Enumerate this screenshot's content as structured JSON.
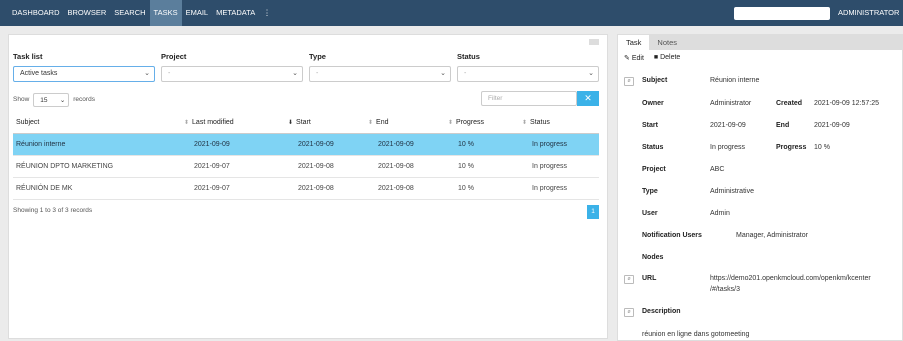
{
  "nav": {
    "items": [
      "DASHBOARD",
      "BROWSER",
      "SEARCH",
      "TASKS",
      "EMAIL",
      "METADATA"
    ],
    "active": "TASKS",
    "more": "⋮",
    "user": "ADMINISTRATOR ▾",
    "search_value": ""
  },
  "filters": {
    "task_list": {
      "label": "Task list",
      "value": "Active tasks"
    },
    "project": {
      "label": "Project",
      "value": "-"
    },
    "type": {
      "label": "Type",
      "value": "-"
    },
    "status": {
      "label": "Status",
      "value": "-"
    }
  },
  "table_controls": {
    "show_label": "Show",
    "show_value": "15",
    "records_label": "records",
    "filter_placeholder": "Filter",
    "filter_button": "✕"
  },
  "columns": [
    "Subject",
    "Last modified",
    "Start",
    "End",
    "Progress",
    "Status"
  ],
  "rows": [
    {
      "subject": "Réunion interne",
      "modified": "2021-09-09",
      "start": "2021-09-09",
      "end": "2021-09-09",
      "progress": "10 %",
      "status": "In progress"
    },
    {
      "subject": "RÉUNION DPTO MARKETING",
      "modified": "2021-09-07",
      "start": "2021-09-08",
      "end": "2021-09-08",
      "progress": "10 %",
      "status": "In progress"
    },
    {
      "subject": "RÉUNIÓN DE MK",
      "modified": "2021-09-07",
      "start": "2021-09-08",
      "end": "2021-09-08",
      "progress": "10 %",
      "status": "In progress"
    }
  ],
  "summary": "Showing 1 to 3 of 3 records",
  "pagination": {
    "current": "1"
  },
  "detail": {
    "tabs": [
      "Task",
      "Notes"
    ],
    "actions": {
      "edit": "Edit",
      "delete": "Delete"
    },
    "subject_label": "Subject",
    "subject": "Réunion interne",
    "owner_label": "Owner",
    "owner": "Administrator",
    "created_label": "Created",
    "created": "2021-09-09 12:57:25",
    "start_label": "Start",
    "start": "2021-09-09",
    "end_label": "End",
    "end": "2021-09-09",
    "status_label": "Status",
    "status": "In progress",
    "progress_label": "Progress",
    "progress": "10 %",
    "project_label": "Project",
    "project": "ABC",
    "type_label": "Type",
    "type": "Administrative",
    "user_label": "User",
    "user": "Admin",
    "notif_label": "Notification Users",
    "notif": "Manager, Administrator",
    "nodes_label": "Nodes",
    "url_label": "URL",
    "url_line1": "https://demo201.openkmcloud.com/openkm/kcenter",
    "url_line2": "/#/tasks/3",
    "description_label": "Description",
    "description": "réunion en ligne dans gotomeeting",
    "pin_glyph": "ø"
  }
}
